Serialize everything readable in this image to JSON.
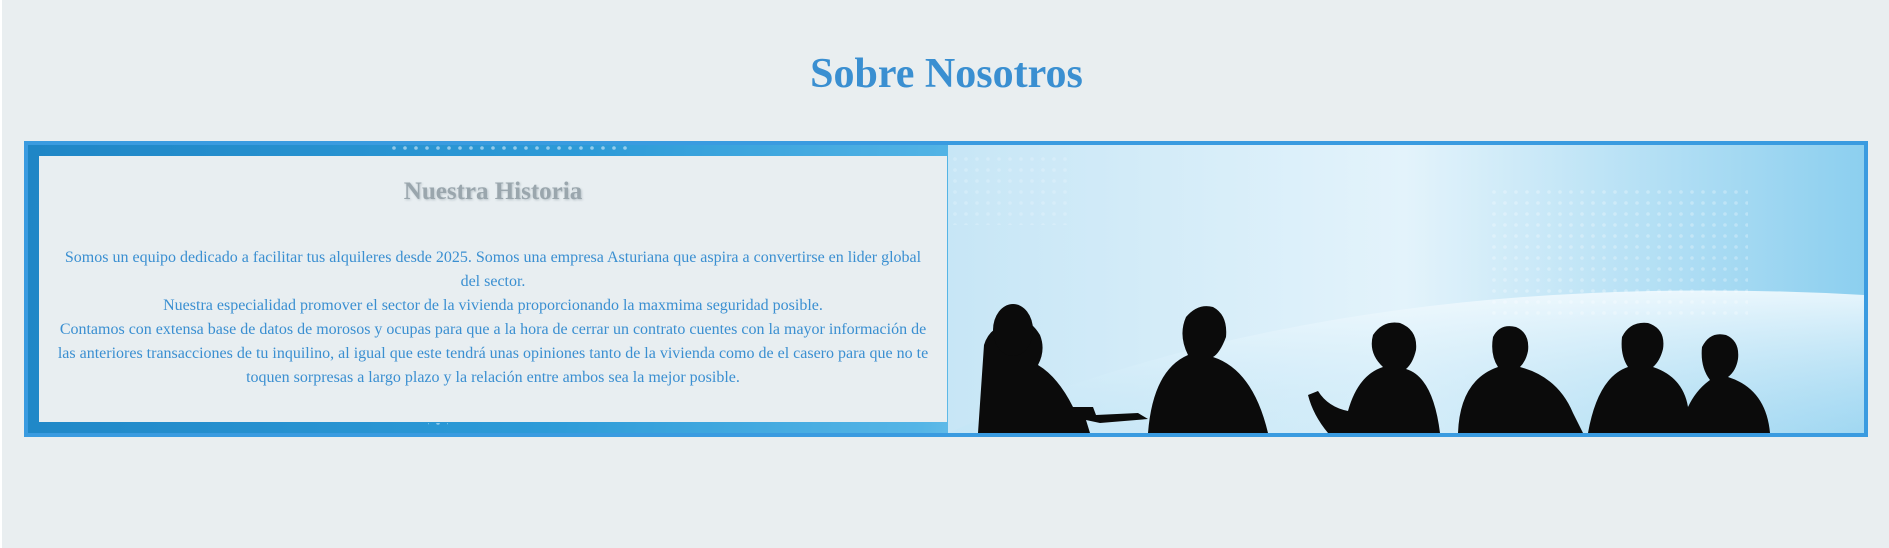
{
  "page": {
    "title": "Sobre Nosotros"
  },
  "history": {
    "title": "Nuestra Historia",
    "paragraphs": [
      "Somos un equipo dedicado a facilitar tus alquileres desde 2025. Somos una empresa Asturiana que aspira a convertirse en lider global del sector.",
      "Nuestra especialidad promover el sector de la vivienda proporcionando la maxmima seguridad posible.",
      "Contamos con extensa base de datos de morosos y ocupas para que a la hora de cerrar un contrato cuentes con la mayor información de las anteriores transacciones de tu inquilino, al igual que este tendrá unas opiniones tanto de la vivienda como de el casero para que no te toquen sorpresas a largo plazo y la relación entre ambos sea la mejor posible."
    ]
  },
  "banner": {
    "image": "business-meeting-silhouettes",
    "accent_color": "#3a9be0"
  }
}
